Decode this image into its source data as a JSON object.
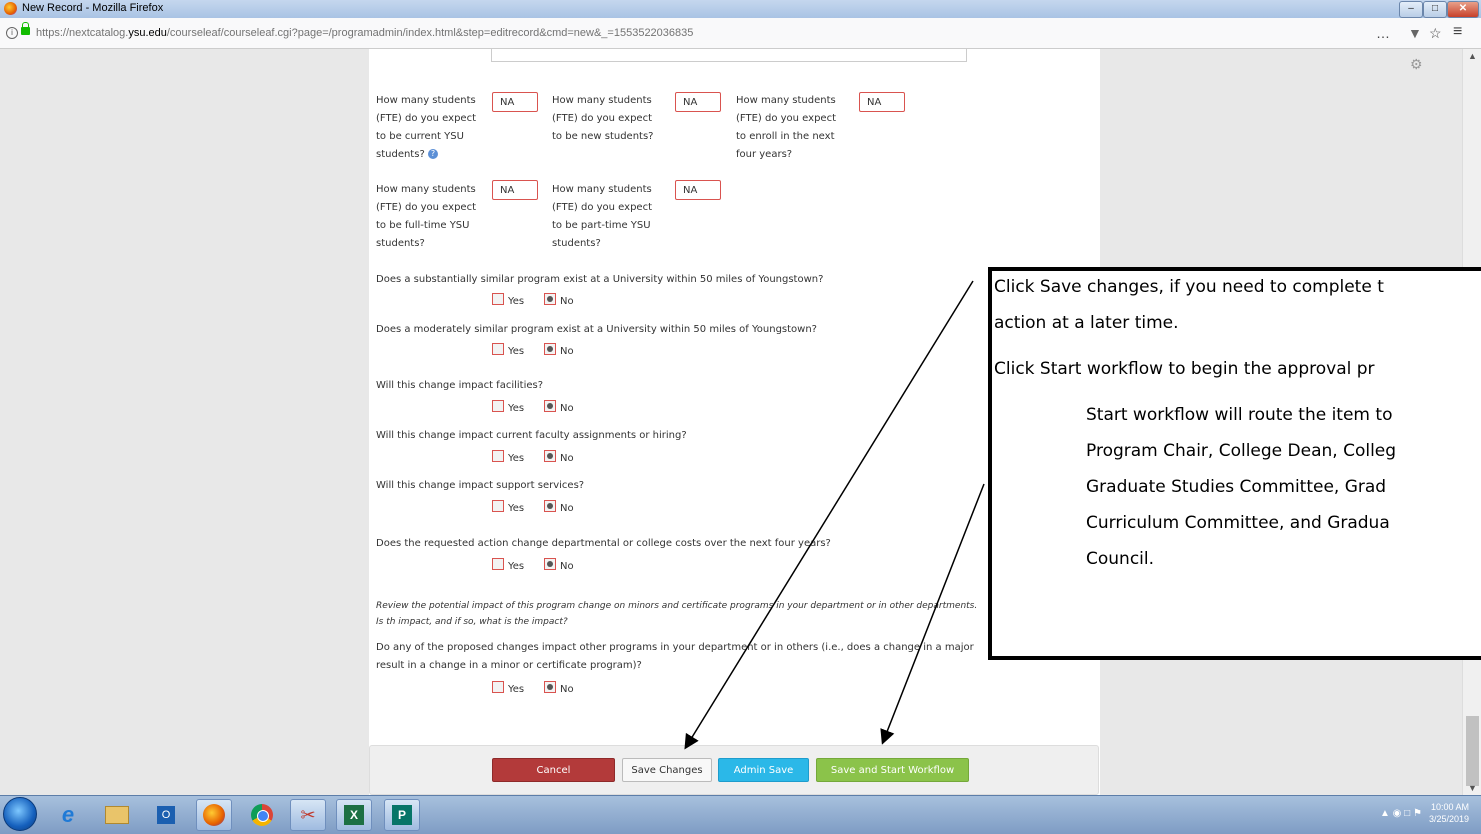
{
  "window": {
    "title": "New Record - Mozilla Firefox"
  },
  "browser": {
    "url_prefix": "https://nextcatalog.",
    "url_domain": "ysu.edu",
    "url_suffix": "/courseleaf/courseleaf.cgi?page=/programadmin/index.html&step=editrecord&cmd=new&_=1553522036835",
    "menu_glyph": "…",
    "pocket_glyph": "▼",
    "bookmark_glyph": "☆",
    "hamburger_glyph": "≡"
  },
  "form": {
    "fte_questions": [
      {
        "label": "How many students (FTE) do you expect to be current YSU students?",
        "value": "NA"
      },
      {
        "label": "How many students (FTE) do you expect to be new students?",
        "value": "NA"
      },
      {
        "label": "How many students (FTE) do you expect to enroll in the next four years?",
        "value": "NA"
      },
      {
        "label": "How many students (FTE) do you expect to be full-time YSU students?",
        "value": "NA"
      },
      {
        "label": "How many students (FTE) do you expect to be part-time YSU students?",
        "value": "NA"
      }
    ],
    "help_glyph": "?",
    "yes_label": "Yes",
    "no_label": "No",
    "radio_questions": [
      {
        "label": "Does a substantially similar program exist at a University within 50 miles of Youngstown?",
        "selected": "No"
      },
      {
        "label": "Does a moderately similar program exist at a University within 50 miles of Youngstown?",
        "selected": "No"
      },
      {
        "label": "Will this change impact facilities?",
        "selected": "No"
      },
      {
        "label": "Will this change impact current faculty assignments or hiring?",
        "selected": "No"
      },
      {
        "label": "Will this change impact support services?",
        "selected": "No"
      },
      {
        "label": "Does the requested action change departmental or college costs over the next four years?",
        "selected": "No"
      },
      {
        "label": "Do any of the proposed changes impact other programs in your department or in others (i.e., does a change in a major result in a change in a minor or certificate program)?",
        "selected": "No"
      }
    ],
    "review_note": "Review the potential impact of this program change on minors and certificate programs in your department or in other departments. Is th impact, and if so, what is the impact?"
  },
  "buttons": {
    "cancel": "Cancel",
    "save_changes": "Save Changes",
    "admin_save": "Admin Save",
    "save_start": "Save and Start Workflow"
  },
  "callout": {
    "line1": "Click Save changes, if you need to complete t",
    "line2": "action at a later time.",
    "line3": "Click Start workflow to begin the approval pr",
    "line4": "Start workflow will route the item to",
    "line5": "Program Chair, College Dean, Colleg",
    "line6": "Graduate Studies Committee,  Grad",
    "line7": "Curriculum Committee, and Gradua",
    "line8": "Council."
  },
  "taskbar": {
    "time": "10:00 AM",
    "date": "3/25/2019"
  },
  "colors": {
    "cancel": "#b33a3a",
    "admin": "#2bb8e8",
    "start": "#8bc34a",
    "invalid_border": "#d9534f"
  }
}
